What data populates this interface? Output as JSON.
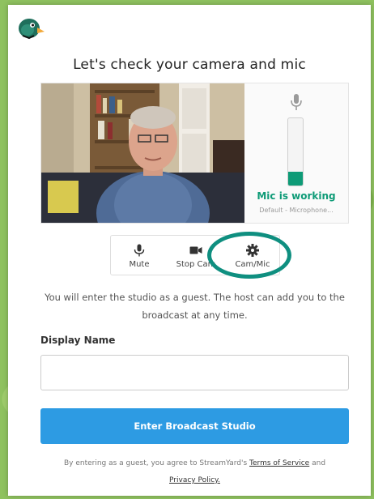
{
  "title": "Let's check your camera and mic",
  "meter": {
    "level": 0.2,
    "status": "Mic is working",
    "device": "Default - Microphone...",
    "color": "#0e9b77"
  },
  "controls": [
    {
      "label": "Mute",
      "icon": "mic-icon"
    },
    {
      "label": "Stop Cam",
      "icon": "camera-icon"
    },
    {
      "label": "Cam/Mic",
      "icon": "gear-icon"
    }
  ],
  "notice": "You will enter the studio as a guest. The host can add you to the broadcast at any time.",
  "display_name": {
    "label": "Display Name",
    "value": "",
    "placeholder": ""
  },
  "enter_button": "Enter Broadcast Studio",
  "terms": {
    "prefix": "By entering as a guest, you agree to StreamYard's",
    "terms_link": "Terms of Service",
    "and": "and",
    "privacy_link": "Privacy Policy."
  },
  "colors": {
    "accent": "#2d9be3",
    "highlight": "#0f8f80",
    "mic_ok": "#0e9b77"
  }
}
